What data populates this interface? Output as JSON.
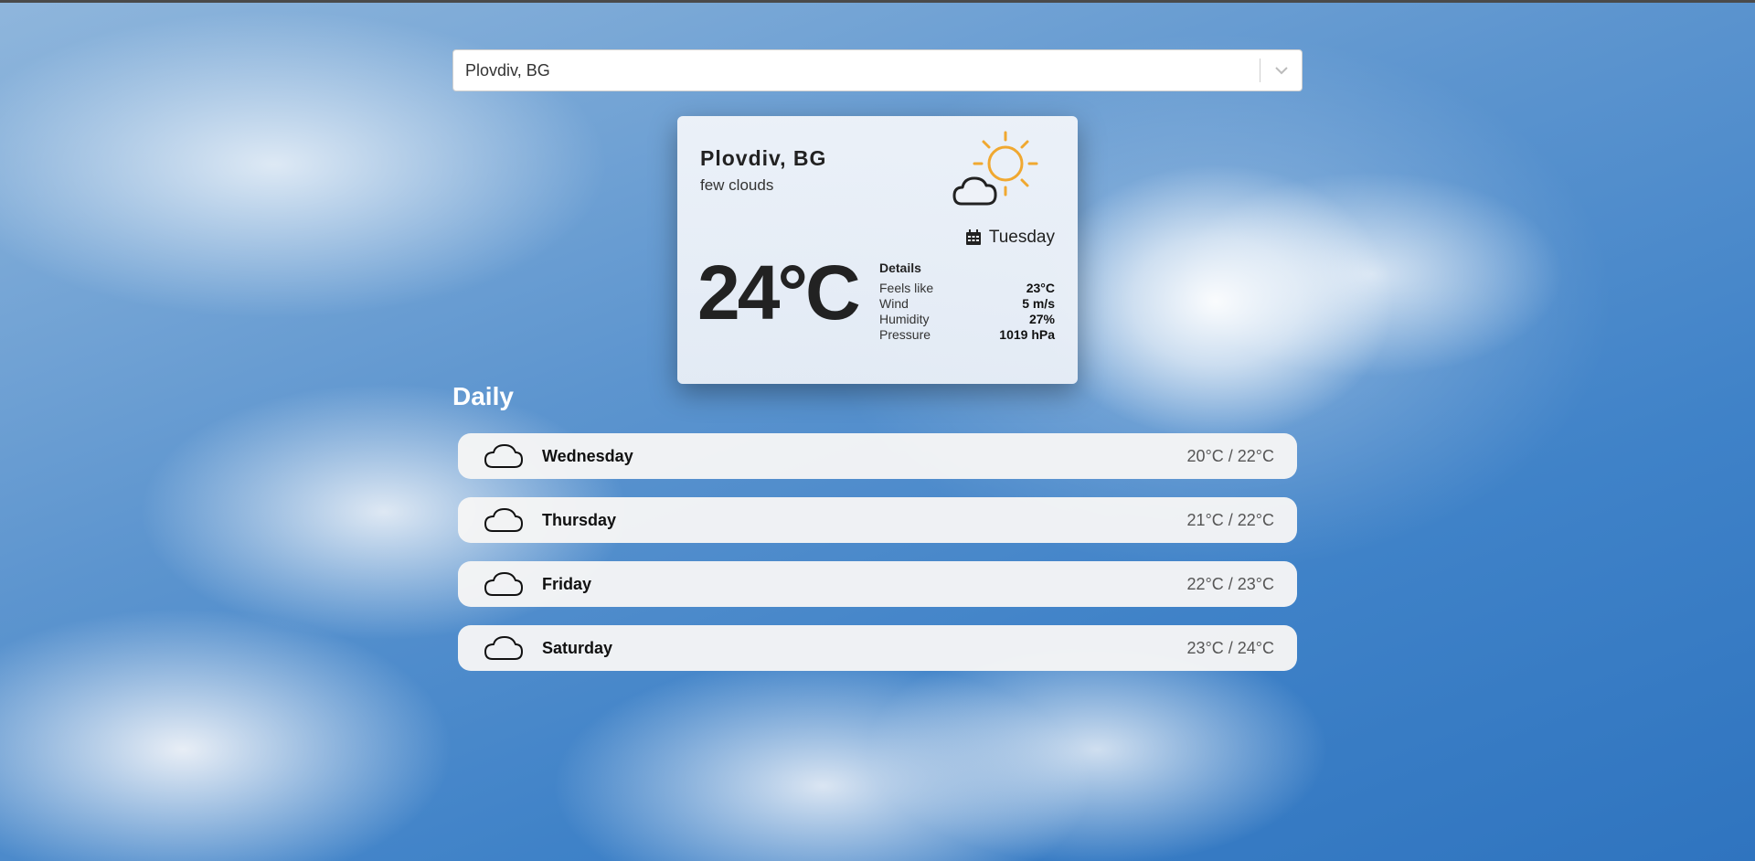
{
  "search": {
    "value": "Plovdiv, BG",
    "chevron_icon": "chevron-down-icon"
  },
  "current": {
    "city": "Plovdiv, BG",
    "description": "few clouds",
    "icon": "sun-cloud-icon",
    "day": "Tuesday",
    "day_icon": "calendar-icon",
    "temperature": "24°C",
    "details_title": "Details",
    "details": [
      {
        "label": "Feels like",
        "value": "23°C"
      },
      {
        "label": "Wind",
        "value": "5 m/s"
      },
      {
        "label": "Humidity",
        "value": "27%"
      },
      {
        "label": "Pressure",
        "value": "1019 hPa"
      }
    ]
  },
  "daily": {
    "title": "Daily",
    "items": [
      {
        "day": "Wednesday",
        "range": "20°C / 22°C",
        "icon": "cloud-icon"
      },
      {
        "day": "Thursday",
        "range": "21°C / 22°C",
        "icon": "cloud-icon"
      },
      {
        "day": "Friday",
        "range": "22°C / 23°C",
        "icon": "cloud-icon"
      },
      {
        "day": "Saturday",
        "range": "23°C / 24°C",
        "icon": "cloud-icon"
      }
    ]
  },
  "colors": {
    "sun": "#f0a830",
    "text_dark": "#222222"
  }
}
